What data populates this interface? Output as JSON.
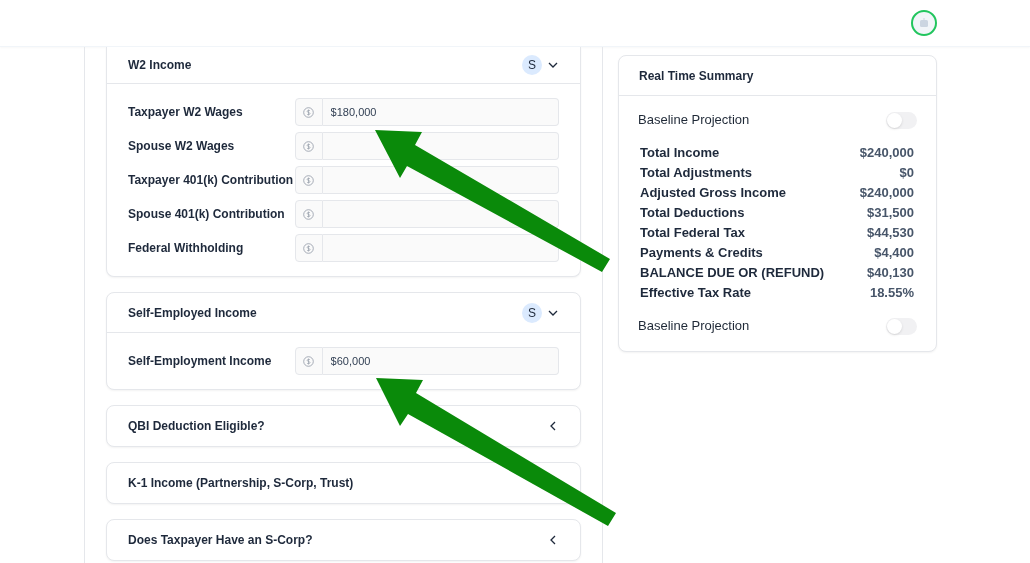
{
  "sections": [
    {
      "title": "W2 Income",
      "badge": "S",
      "expanded": true,
      "fields": [
        {
          "label": "Taxpayer W2 Wages",
          "value": "$180,000"
        },
        {
          "label": "Spouse W2 Wages"
        },
        {
          "label": "Taxpayer 401(k) Contribution"
        },
        {
          "label": "Spouse 401(k) Contribution"
        },
        {
          "label": "Federal Withholding"
        }
      ]
    },
    {
      "title": "Self-Employed Income",
      "badge": "S",
      "expanded": true,
      "fields": [
        {
          "label": "Self-Employment Income",
          "value": "$60,000"
        }
      ]
    },
    {
      "title": "QBI Deduction Eligible?",
      "expanded": false
    },
    {
      "title": "K-1 Income (Partnership, S-Corp, Trust)"
    },
    {
      "title": "Does Taxpayer Have an S-Corp?",
      "expanded": false
    }
  ],
  "summary": {
    "title": "Real Time Summary",
    "toggle_top": {
      "label": "Baseline Projection",
      "on": false
    },
    "rows": [
      {
        "label": "Total Income",
        "value": "$240,000"
      },
      {
        "label": "Total Adjustments",
        "value": "$0"
      },
      {
        "label": "Adjusted Gross Income",
        "value": "$240,000"
      },
      {
        "label": "Total Deductions",
        "value": "$31,500"
      },
      {
        "label": "Total Federal Tax",
        "value": "$44,530"
      },
      {
        "label": "Payments & Credits",
        "value": "$4,400"
      },
      {
        "label": "BALANCE DUE OR (REFUND)",
        "value": "$40,130"
      },
      {
        "label": "Effective Tax Rate",
        "value": "18.55%"
      }
    ],
    "toggle_bottom": {
      "label": "Baseline Projection",
      "on": false
    }
  }
}
